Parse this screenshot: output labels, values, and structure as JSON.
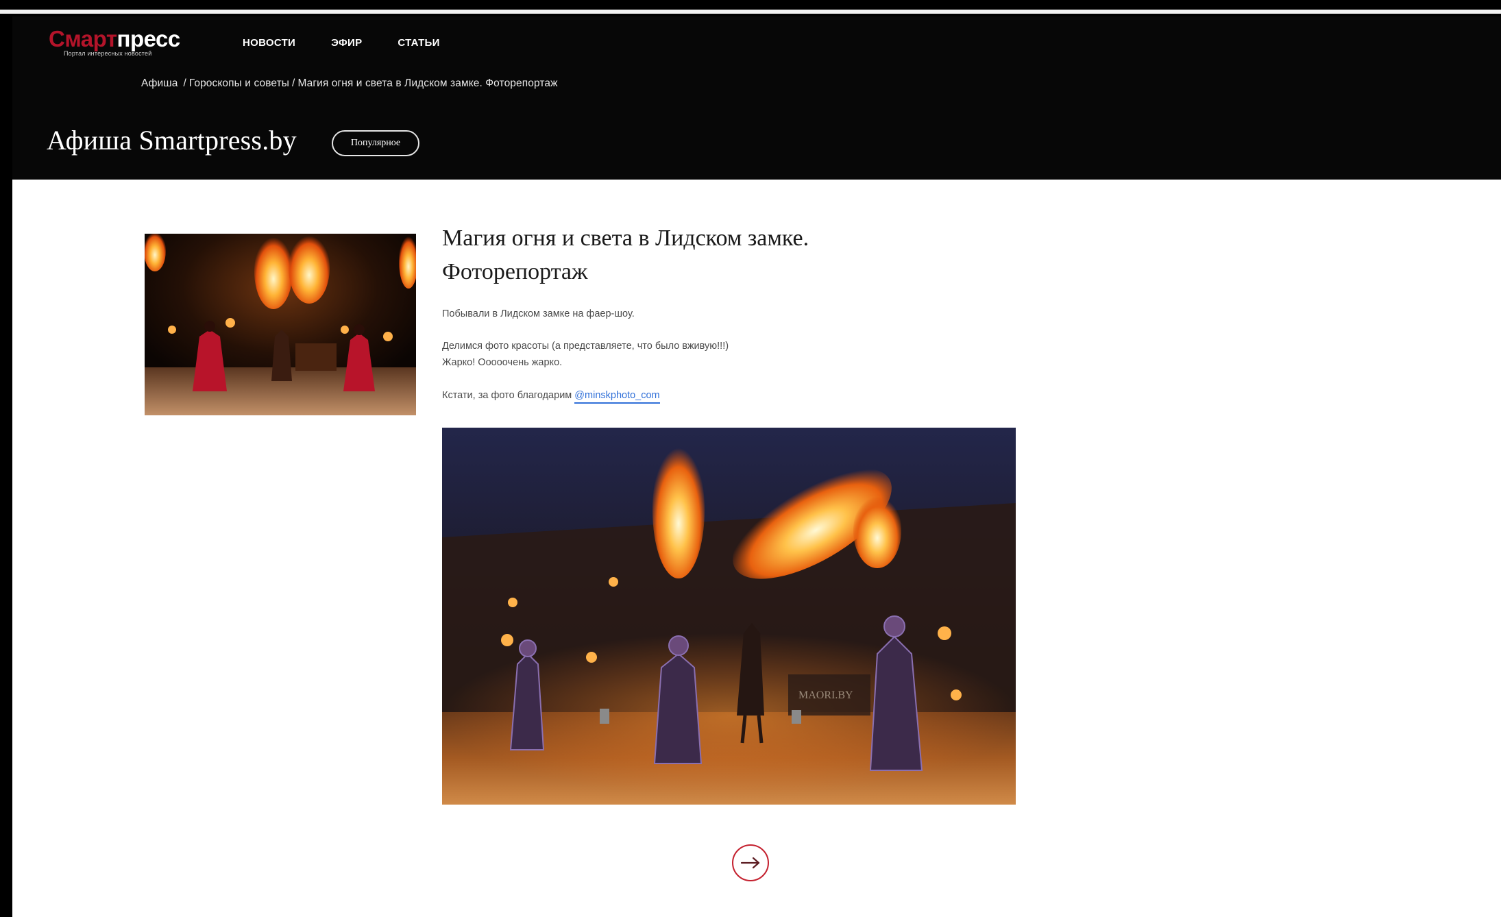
{
  "header": {
    "logo": {
      "part1": "Смарт",
      "part2": "пресс",
      "tagline": "Портал интересных новостей"
    },
    "nav": [
      {
        "label": "НОВОСТИ"
      },
      {
        "label": "ЭФИР"
      },
      {
        "label": "СТАТЬИ"
      }
    ],
    "breadcrumb": {
      "items": [
        "Афиша",
        "Гороскопы и советы",
        "Магия огня и света в Лидском замке. Фоторепортаж"
      ],
      "separator": "/"
    },
    "section_title": "Афиша Smartpress.by",
    "popular_button": "Популярное"
  },
  "article": {
    "title_line1": "Магия огня и света в Лидском замке.",
    "title_line2": "Фоторепортаж",
    "paragraphs": [
      "Побывали в Лидском замке на фаер-шоу.",
      "Делимся фото красоты (а представляете, что было вживую!!!)",
      "Жарко! Ооооочень жарко.",
      "Кстати, за фото благодарим"
    ],
    "credit_link": "@minskphoto_com",
    "photo_watermark": "MAORI.BY"
  },
  "colors": {
    "brand_red": "#b4142a",
    "link_blue": "#2f6fd8",
    "header_bg": "#070707",
    "arrow_red": "#c4202e"
  },
  "icons": {
    "next": "arrow-right-icon"
  }
}
